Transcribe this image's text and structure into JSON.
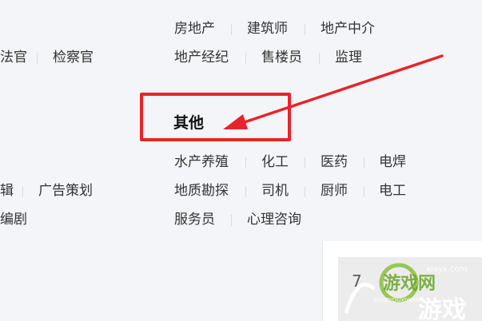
{
  "categories": {
    "left_col": {
      "row1": [
        "法官",
        "检察官"
      ],
      "row2": [
        "辑",
        "广告策划"
      ],
      "row3": [
        "编剧"
      ]
    },
    "right_col_top": {
      "row1": [
        "房地产",
        "建筑师",
        "地产中介"
      ],
      "row2": [
        "地产经纪",
        "售楼员",
        "监理"
      ]
    },
    "other_heading": "其他",
    "right_col_other": {
      "row1": [
        "水产养殖",
        "化工",
        "医药",
        "电焊"
      ],
      "row2": [
        "地质勘探",
        "司机",
        "厨师",
        "电工"
      ],
      "row3": [
        "服务员",
        "心理咨询"
      ]
    }
  },
  "panel": {
    "text": "7"
  },
  "watermark": {
    "brand": "游戏网",
    "sub": "ZHAOYOUXIWANG",
    "main": "游戏",
    "domain": "xiayx.com"
  },
  "colors": {
    "highlight": "#e8242a",
    "text": "#333333",
    "separator": "#d7dbe2"
  }
}
